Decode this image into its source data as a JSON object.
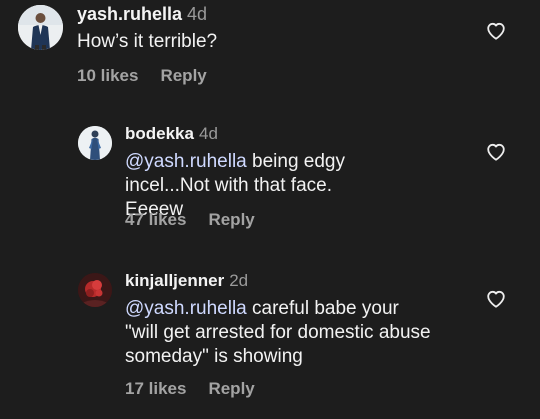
{
  "comments": [
    {
      "username": "yash.ruhella",
      "time": "4d",
      "mention": "",
      "text": "How’s it terrible?",
      "likes": "10 likes",
      "reply": "Reply",
      "avatar": "avatar-man-suit"
    },
    {
      "username": "bodekka",
      "time": "4d",
      "mention": "@yash.ruhella",
      "text": " being edgy incel...Not with that face. Eeeew",
      "likes": "47 likes",
      "reply": "Reply",
      "avatar": "avatar-silhouette"
    },
    {
      "username": "kinjalljenner",
      "time": "2d",
      "mention": "@yash.ruhella",
      "text": " careful babe your \"will get arrested for domestic abuse someday\" is showing",
      "likes": "17 likes",
      "reply": "Reply",
      "avatar": "avatar-red-flower"
    }
  ],
  "icons": {
    "like": "heart-outline-icon"
  },
  "colors": {
    "background": "#1d1d1d",
    "text": "#f2f2f2",
    "mention": "#cfd9ff",
    "muted": "#a3a3a3"
  }
}
